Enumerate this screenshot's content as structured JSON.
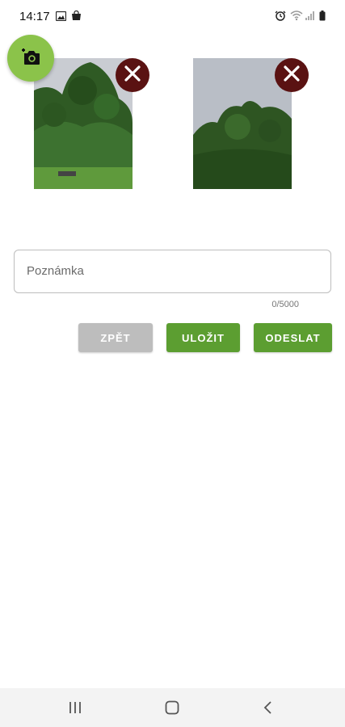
{
  "status_bar": {
    "time": "14:17"
  },
  "photos": [
    {
      "alt": "photo-1"
    },
    {
      "alt": "photo-2"
    }
  ],
  "note": {
    "placeholder": "Poznámka",
    "counter": "0/5000"
  },
  "buttons": {
    "back": "ZPĚT",
    "save": "ULOŽIT",
    "send": "ODESLAT"
  },
  "colors": {
    "fab": "#8bc34a",
    "primary_button": "#5c9e31",
    "disabled_button": "#bdbdbd",
    "remove_button": "#5a1212"
  }
}
